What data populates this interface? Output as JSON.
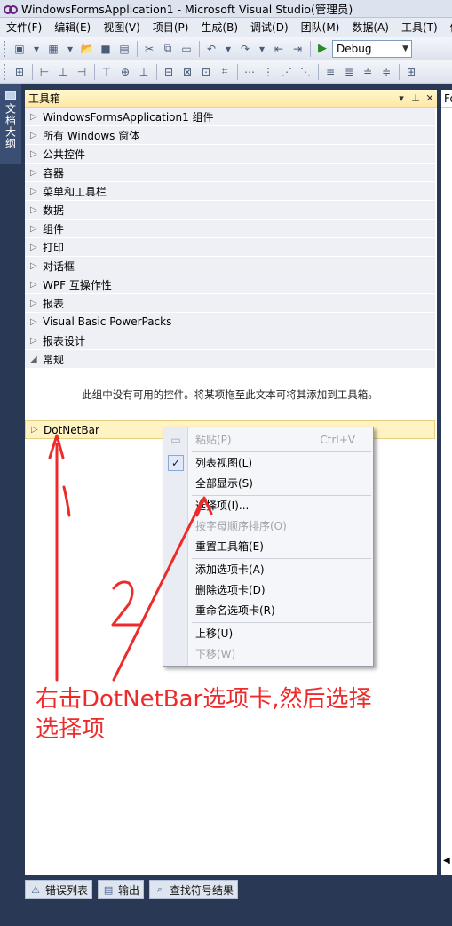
{
  "window": {
    "title": "WindowsFormsApplication1 - Microsoft Visual Studio(管理员)"
  },
  "menu": [
    "文件(F)",
    "编辑(E)",
    "视图(V)",
    "项目(P)",
    "生成(B)",
    "调试(D)",
    "团队(M)",
    "数据(A)",
    "工具(T)",
    "体系"
  ],
  "toolbar": {
    "config": "Debug"
  },
  "left_tab": {
    "label": "文档大纲"
  },
  "toolbox": {
    "title": "工具箱",
    "categories": [
      "WindowsFormsApplication1 组件",
      "所有 Windows 窗体",
      "公共控件",
      "容器",
      "菜单和工具栏",
      "数据",
      "组件",
      "打印",
      "对话框",
      "WPF 互操作性",
      "报表",
      "Visual Basic PowerPacks",
      "报表设计"
    ],
    "expanded_category": "常规",
    "empty_message": "此组中没有可用的控件。将某项拖至此文本可将其添加到工具箱。",
    "selected_category": "DotNetBar"
  },
  "doc_window": {
    "tab": "Fo"
  },
  "context_menu": {
    "items": [
      {
        "label": "粘贴(P)",
        "shortcut": "Ctrl+V",
        "enabled": false,
        "icon": "paste-icon"
      },
      {
        "label": "列表视图(L)",
        "checked": true,
        "enabled": true
      },
      {
        "label": "全部显示(S)",
        "enabled": true
      },
      {
        "label": "选择项(I)...",
        "enabled": true
      },
      {
        "label": "按字母顺序排序(O)",
        "enabled": false
      },
      {
        "label": "重置工具箱(E)",
        "enabled": true
      },
      {
        "label": "添加选项卡(A)",
        "enabled": true
      },
      {
        "label": "删除选项卡(D)",
        "enabled": true
      },
      {
        "label": "重命名选项卡(R)",
        "enabled": true
      },
      {
        "label": "上移(U)",
        "enabled": true
      },
      {
        "label": "下移(W)",
        "enabled": false
      }
    ]
  },
  "annotation": {
    "step1": "1",
    "step2": "2",
    "line1": "右击DotNetBar选项卡,然后选择",
    "line2": "选择项",
    "color": "#ee2b2b"
  },
  "bottom_tabs": [
    "错误列表",
    "输出",
    "查找符号结果"
  ]
}
